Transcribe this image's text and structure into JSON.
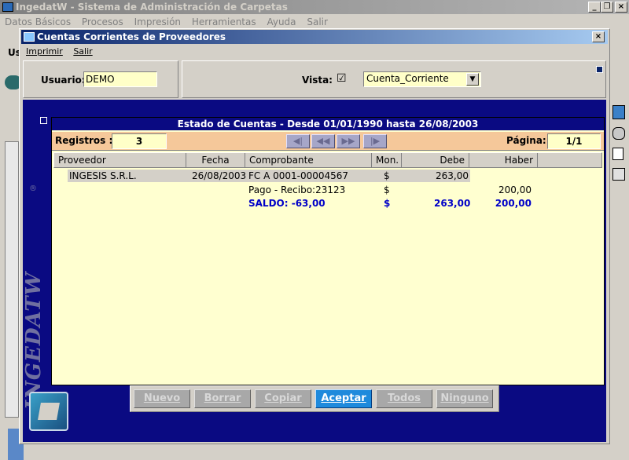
{
  "app": {
    "title": "IngedatW - Sistema de Administración de Carpetas",
    "menu": [
      "Datos Básicos",
      "Procesos",
      "Impresión",
      "Herramientas",
      "Ayuda",
      "Salir"
    ],
    "behind_label": "Us"
  },
  "window": {
    "title": "Cuentas Corrientes de Proveedores",
    "menu": [
      "Imprimir",
      "Salir"
    ]
  },
  "filters": {
    "usuario_label": "Usuario:",
    "usuario_value": "DEMO",
    "vista_label": "Vista:",
    "vista_checkbox": "☑",
    "vista_value": "Cuenta_Corriente"
  },
  "report": {
    "title": "Estado de Cuentas - Desde 01/01/1990 hasta 26/08/2003",
    "registros_label": "Registros :",
    "registros_value": "3",
    "pagina_label": "Página:",
    "pagina_value": "1/1",
    "columns": [
      "Proveedor",
      "Fecha",
      "Comprobante",
      "Mon.",
      "Debe",
      "Haber"
    ],
    "rows": [
      {
        "proveedor": "INGESIS S.R.L.",
        "fecha": "26/08/2003",
        "comprobante": "FC A 0001-00004567",
        "mon": "$",
        "debe": "263,00",
        "haber": ""
      },
      {
        "proveedor": "",
        "fecha": "",
        "comprobante": "Pago - Recibo:23123",
        "mon": "$",
        "debe": "",
        "haber": "200,00"
      }
    ],
    "saldo": {
      "label": "SALDO: -63,00",
      "mon": "$",
      "debe": "263,00",
      "haber": "200,00"
    }
  },
  "brand": {
    "vertical_text": "INGEDATW",
    "registered": "®"
  },
  "buttons": {
    "nuevo": "Nuevo",
    "borrar": "Borrar",
    "copiar": "Copiar",
    "aceptar": "Aceptar",
    "todos": "Todos",
    "ninguno": "Ninguno"
  },
  "colors": {
    "accent": "#0a0a82",
    "field": "#ffffc8",
    "header_strip": "#f5c89a",
    "grid": "#ffffd0",
    "saldo_text": "#0000c8"
  }
}
